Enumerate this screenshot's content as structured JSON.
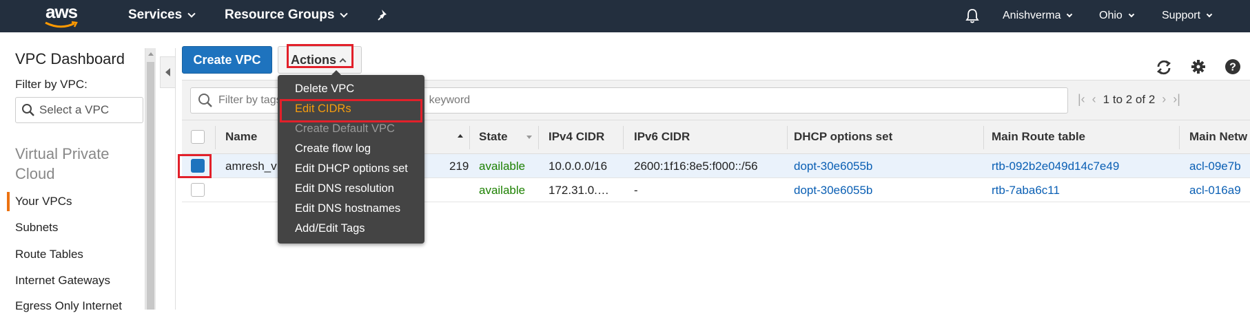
{
  "topnav": {
    "logo": "aws",
    "services": "Services",
    "resource_groups": "Resource Groups",
    "user": "Anishverma",
    "region": "Ohio",
    "support": "Support"
  },
  "sidebar": {
    "title": "VPC Dashboard",
    "filter_label": "Filter by VPC:",
    "vpc_placeholder": "Select a VPC",
    "section": "Virtual Private Cloud",
    "items": [
      "Your VPCs",
      "Subnets",
      "Route Tables",
      "Internet Gateways",
      "Egress Only Internet"
    ]
  },
  "toolbar": {
    "create_label": "Create VPC",
    "actions_label": "Actions"
  },
  "filter": {
    "placeholder_left": "Filter by tags",
    "placeholder_right": "keyword",
    "pager_text": "1 to 2 of 2"
  },
  "table": {
    "columns": [
      "Name",
      "State",
      "IPv4 CIDR",
      "IPv6 CIDR",
      "DHCP options set",
      "Main Route table",
      "Main Netw"
    ],
    "rows": [
      {
        "name": "amresh_v",
        "id_suffix": "219",
        "state": "available",
        "ipv4": "10.0.0.0/16",
        "ipv6": "2600:1f16:8e5:f000::/56",
        "dhcp": "dopt-30e6055b",
        "route": "rtb-092b2e049d14c7e49",
        "acl": "acl-09e7b",
        "selected": true
      },
      {
        "name": "",
        "id_suffix": "",
        "state": "available",
        "ipv4": "172.31.0.…",
        "ipv6": "-",
        "dhcp": "dopt-30e6055b",
        "route": "rtb-7aba6c11",
        "acl": "acl-016a9",
        "selected": false
      }
    ]
  },
  "menu": {
    "items": [
      "Delete VPC",
      "Edit CIDRs",
      "Create Default VPC",
      "Create flow log",
      "Edit DHCP options set",
      "Edit DNS resolution",
      "Edit DNS hostnames",
      "Add/Edit Tags"
    ],
    "highlighted": "Edit CIDRs",
    "disabled": "Create Default VPC"
  },
  "colors": {
    "nav_bg": "#232f3e",
    "primary_button": "#1e73be",
    "highlight": "#f59d0e",
    "annotation_red": "#e2202a",
    "available_green": "#1d8102",
    "link_blue": "#0a5fb4"
  },
  "icons": [
    "bell-icon",
    "pin-icon",
    "refresh-icon",
    "gear-icon",
    "help-icon",
    "search-icon"
  ]
}
